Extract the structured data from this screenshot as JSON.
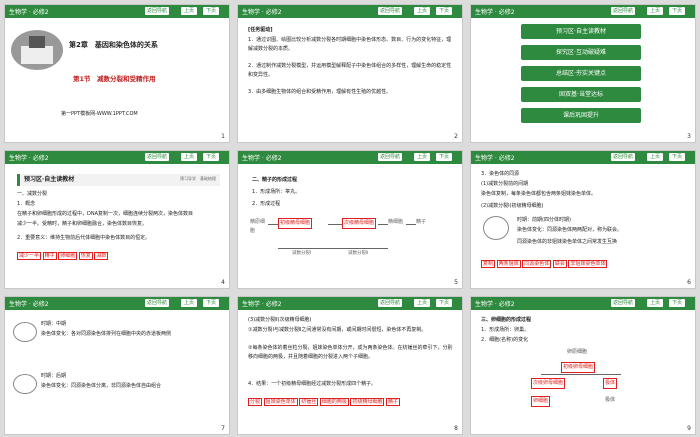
{
  "header": {
    "subject": "生物学 · 必修2",
    "nav": "返回导航",
    "prev": "上页",
    "next": "下页"
  },
  "slides": [
    {
      "num": "1",
      "chapter": "第2章　基因和染色体的关系",
      "section": "第1节　减数分裂和受精作用",
      "footer": "第一PPT模板网-WWW.1PPT.COM"
    },
    {
      "num": "2",
      "title": "[任务驱动]",
      "lines": [
        "1．通过识图、绘图比较分析减数分裂各时期细胞中染色体形态、数目、行为的变化特征，理解减数分裂的本质。",
        "2．通过制作减数分裂模型，并运用模型解释配子中染色体组合的多样性，理解生命的稳定性和变异性。",
        "3．由多细胞生物体的组合和受精作用，理解有性生殖的优越性。"
      ]
    },
    {
      "num": "3",
      "items": [
        "预习区·自主读教材",
        "探究区·互动破疑难",
        "总结区·夯实关键点",
        "固双基·当堂达标",
        "课后巩固提升"
      ]
    },
    {
      "num": "4",
      "title": "预习区·自主读教材",
      "tag": "预习导学　基础梳理",
      "lines": [
        "一、减数分裂",
        "1．概念",
        "在精子和卵细胞形成的过程中，DNA复制一次，细胞连续分裂两次，染色体数目",
        "减少一半。受精时，精子和卵细胞融合，染色体数目恢复。",
        "2．重要意义：维持生物前后代体细胞中染色体数目的恒定。"
      ],
      "blanks": [
        "减少一半",
        "精子",
        "卵细胞",
        "恢复",
        "减数"
      ]
    },
    {
      "num": "5",
      "lines": [
        "二、精子的形成过程",
        "1．形成场所：睾丸。",
        "2．形成过程"
      ],
      "flow": [
        "精原细胞",
        "初级精母细胞",
        "次级精母细胞",
        "精细胞",
        "精子"
      ],
      "stage": [
        "减数分裂Ⅰ",
        "减数分裂Ⅱ"
      ]
    },
    {
      "num": "6",
      "lines": [
        "3．染色体的同源",
        "(1)减数分裂前的间期",
        "染色体复制，每条染色体都包含两条姐妹染色单体。",
        "(2)减数分裂Ⅰ(初级精母细胞)",
        "时期：前期(四分体时期)",
        "染色体变化：同源染色体两两配对，称为联会。",
        "同源染色体的非姐妹染色单体之间常发生互换"
      ],
      "blanks": [
        "复制",
        "两条姐妹",
        "同源染色体",
        "联会",
        "非姐妹染色单体"
      ]
    },
    {
      "num": "7",
      "rows": [
        {
          "label": "时期：中期",
          "text": "染色体变化：各对同源染色体排列在细胞中央的赤道板两侧"
        },
        {
          "label": "时期：后期",
          "text": "染色体变化：同源染色体分离，非同源染色体自由组合"
        }
      ]
    },
    {
      "num": "8",
      "lines": [
        "(3)减数分裂Ⅱ(次级精母细胞)",
        "①减数分裂Ⅰ与减数分裂Ⅱ之间通常没有间期，或间期时间很短，染色体不再复制。",
        "②每条染色体的着丝粒分裂，姐妹染色单体分开，成为两条染色体。在纺锤丝的牵引下，分别移向细胞的两极，并且随着细胞的分裂进入两个子细胞。",
        "4．结果：一个初级精母细胞经过减数分裂形成四个精子。"
      ],
      "blanks": [
        "分裂",
        "姐妹染色单体",
        "纺锤丝",
        "细胞的两极",
        "初级精母细胞",
        "精子"
      ]
    },
    {
      "num": "9",
      "lines": [
        "三、卵细胞的形成过程",
        "1．形成场所：卵巢。",
        "2．细胞(名称)的变化"
      ],
      "tree": [
        "卵原细胞",
        "初级卵母细胞",
        "次级卵母细胞",
        "极体",
        "卵细胞",
        "极体"
      ]
    }
  ]
}
